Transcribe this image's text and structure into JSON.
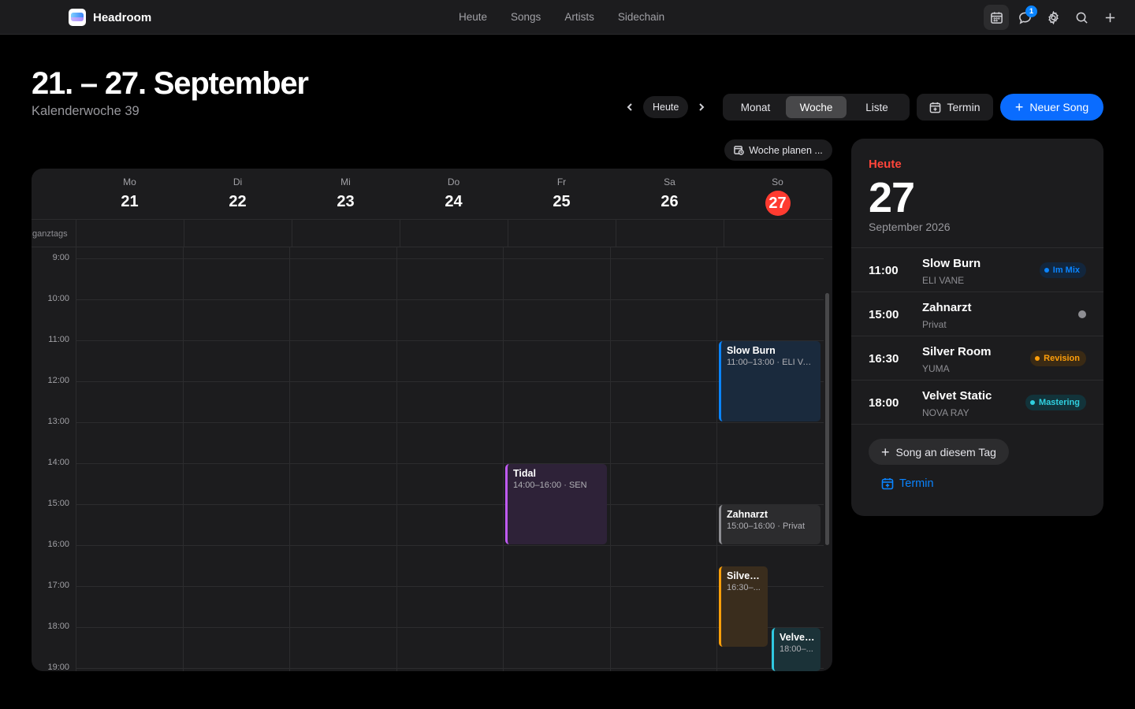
{
  "app": {
    "name": "Headroom"
  },
  "nav": [
    "Heute",
    "Songs",
    "Artists",
    "Sidechain"
  ],
  "notifications": {
    "count": "1"
  },
  "header": {
    "title": "21. – 27. September",
    "subtitle": "Kalenderwoche 39"
  },
  "toolbar": {
    "today": "Heute",
    "views": [
      "Monat",
      "Woche",
      "Liste"
    ],
    "selected_view": "Woche",
    "termin": "Termin",
    "new_song": "Neuer Song",
    "plan_week": "Woche planen ..."
  },
  "calendar": {
    "allday_label": "ganztags",
    "days": [
      {
        "name": "Mo",
        "date": "21"
      },
      {
        "name": "Di",
        "date": "22"
      },
      {
        "name": "Mi",
        "date": "23"
      },
      {
        "name": "Do",
        "date": "24"
      },
      {
        "name": "Fr",
        "date": "25"
      },
      {
        "name": "Sa",
        "date": "26"
      },
      {
        "name": "So",
        "date": "27",
        "today": true
      }
    ],
    "hours": [
      "9:00",
      "10:00",
      "11:00",
      "12:00",
      "13:00",
      "14:00",
      "15:00",
      "16:00",
      "17:00",
      "18:00",
      "19:00"
    ],
    "events": [
      {
        "title": "Slow Burn",
        "sub": "11:00–13:00 · ELI VA...",
        "day": 6,
        "start": 11,
        "end": 13,
        "lane": "full",
        "color": "#0a84ff",
        "bg": "#1a2a3d"
      },
      {
        "title": "Tidal",
        "sub": "14:00–16:00 · SEN",
        "day": 4,
        "start": 14,
        "end": 16,
        "lane": "full",
        "color": "#bf5af2",
        "bg": "#2e2238"
      },
      {
        "title": "Zahnarzt",
        "sub": "15:00–16:00 · Privat",
        "day": 6,
        "start": 15,
        "end": 16,
        "lane": "full",
        "color": "#8e8e93",
        "bg": "#2c2c2e"
      },
      {
        "title": "Silver ...",
        "sub": "16:30–...",
        "day": 6,
        "start": 16.5,
        "end": 18.5,
        "lane": "left",
        "color": "#ff9f0a",
        "bg": "#3a2d1d"
      },
      {
        "title": "Velvet...",
        "sub": "18:00–...",
        "day": 6,
        "start": 18,
        "end": 20,
        "lane": "right",
        "color": "#30c8e0",
        "bg": "#1b3238"
      }
    ]
  },
  "side": {
    "today_label": "Heute",
    "day": "27",
    "month": "September 2026",
    "items": [
      {
        "time": "11:00",
        "name": "Slow Burn",
        "artist": "ELI VANE",
        "status": "Im Mix",
        "color": "#0a84ff",
        "bg": "#12263d"
      },
      {
        "time": "15:00",
        "name": "Zahnarzt",
        "artist": "Privat",
        "status": "",
        "color": "#8e8e93",
        "bg": ""
      },
      {
        "time": "16:30",
        "name": "Silver Room",
        "artist": "YUMA",
        "status": "Revision",
        "color": "#ff9f0a",
        "bg": "#3a2a14"
      },
      {
        "time": "18:00",
        "name": "Velvet Static",
        "artist": "NOVA RAY",
        "status": "Mastering",
        "color": "#30d0e0",
        "bg": "#12333a"
      }
    ],
    "add_song": "Song an diesem Tag",
    "termin": "Termin"
  }
}
